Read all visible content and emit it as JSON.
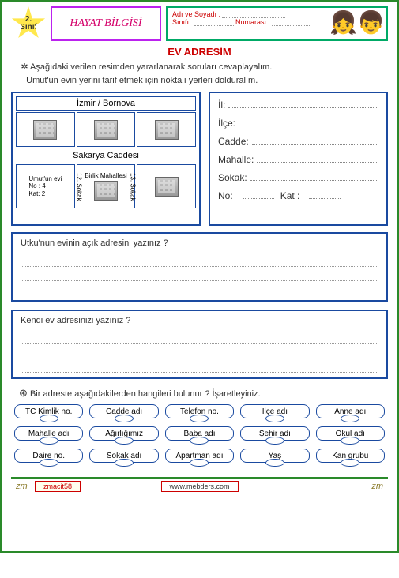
{
  "grade": {
    "num": "2.",
    "label": "Sınıf"
  },
  "subject": "HAYAT BİLGİSİ",
  "student_fields": {
    "name_label": "Adı ve Soyadı :",
    "class_label": "Sınıfı :",
    "number_label": "Numarası :"
  },
  "title": "EV ADRESİM",
  "instructions": {
    "line1": "Aşağıdaki verilen resimden yararlanarak soruları cevaplayalım.",
    "line2": "Umut'un evin yerini tarif etmek için noktalı yerleri dolduralım."
  },
  "map": {
    "district": "İzmir / Bornova",
    "street": "Sakarya  Caddesi",
    "neighborhood": "Birlik Mahallesi",
    "house": {
      "title": "Umut'un evi",
      "no": "No : 4",
      "floor": "Kat: 2"
    },
    "side1": "12. Sokak",
    "side2": "13. Sokak"
  },
  "address_form": {
    "il": "İl:",
    "ilce": "İlçe:",
    "cadde": "Cadde:",
    "mahalle": "Mahalle:",
    "sokak": "Sokak:",
    "no": "No:",
    "kat": "Kat :"
  },
  "q1": "Utku'nun evinin açık adresini yazınız ?",
  "q2": "Kendi ev adresinizi yazınız ?",
  "check_instr": "Bir adreste aşağıdakilerden hangileri  bulunur ? İşaretleyiniz.",
  "chips": [
    "TC  Kimlik no.",
    "Cadde adı",
    "Telefon no.",
    "İlçe adı",
    "Anne adı",
    "Mahalle adı",
    "Ağırlığımız",
    "Baba  adı",
    "Şehir adı",
    "Okul adı",
    "Daire no.",
    "Sokak adı",
    "Apartman adı",
    "Yaş",
    "Kan grubu"
  ],
  "footer": {
    "code": "zmacit58",
    "site": "www.mebders.com",
    "sig": "zm"
  }
}
